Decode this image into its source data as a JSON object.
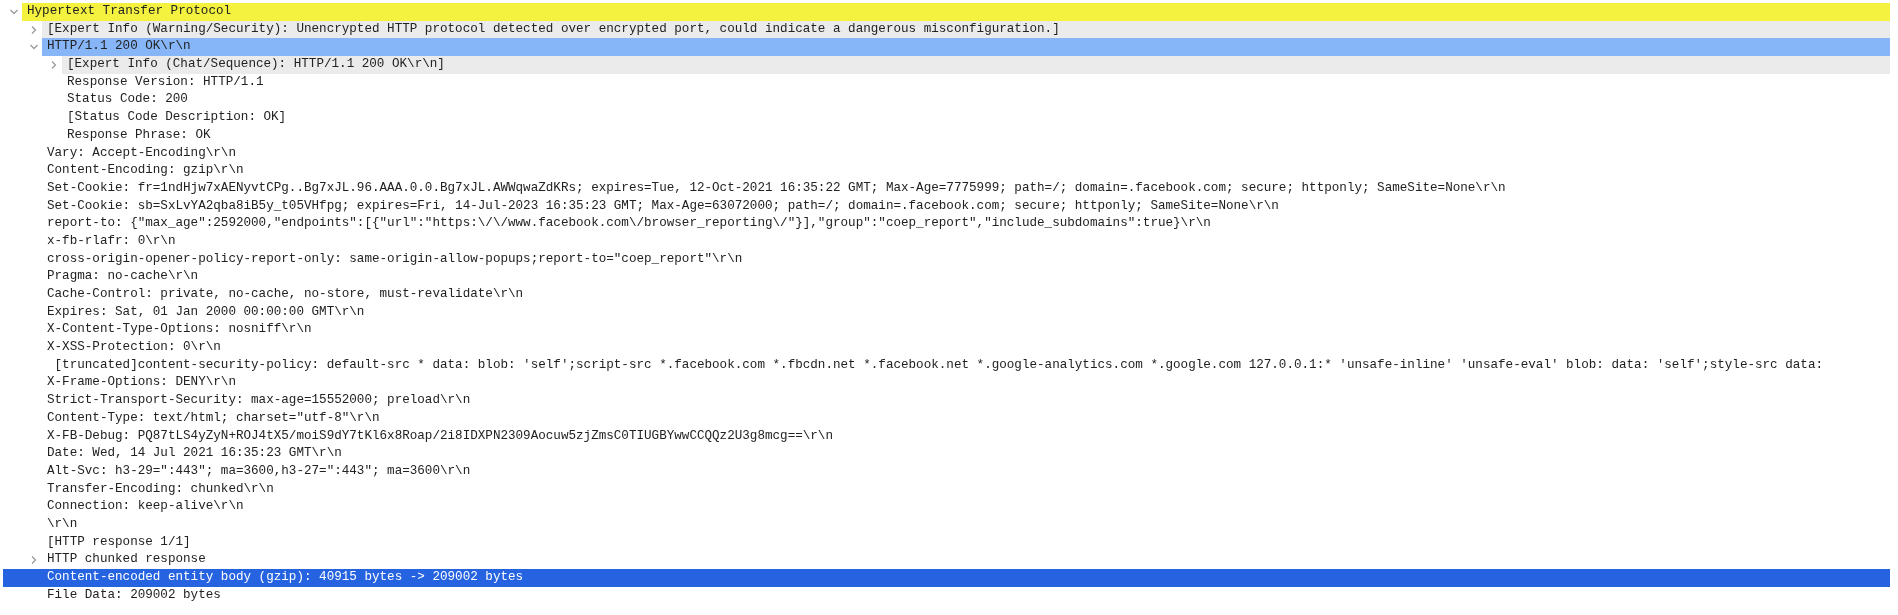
{
  "tree": [
    {
      "label": "Hypertext Transfer Protocol",
      "expanded": true,
      "color": "#f4f23e",
      "selected": false,
      "children": [
        {
          "label": "[Expert Info (Warning/Security): Unencrypted HTTP protocol detected over encrypted port, could indicate a dangerous misconfiguration.]",
          "expanded": false,
          "color": "#ebebeb",
          "selected": false
        },
        {
          "label": "HTTP/1.1 200 OK\\r\\n",
          "expanded": true,
          "color": "#86b6f8",
          "selected": false,
          "children": [
            {
              "label": "[Expert Info (Chat/Sequence): HTTP/1.1 200 OK\\r\\n]",
              "expanded": false,
              "color": "#ebebeb",
              "selected": false
            },
            {
              "label": "Response Version: HTTP/1.1",
              "selected": false
            },
            {
              "label": "Status Code: 200",
              "selected": false
            },
            {
              "label": "[Status Code Description: OK]",
              "selected": false
            },
            {
              "label": "Response Phrase: OK",
              "selected": false
            }
          ]
        },
        {
          "label": "Vary: Accept-Encoding\\r\\n",
          "selected": false
        },
        {
          "label": "Content-Encoding: gzip\\r\\n",
          "selected": false
        },
        {
          "label": "Set-Cookie: fr=1ndHjw7xAENyvtCPg..Bg7xJL.96.AAA.0.0.Bg7xJL.AWWqwaZdKRs; expires=Tue, 12-Oct-2021 16:35:22 GMT; Max-Age=7775999; path=/; domain=.facebook.com; secure; httponly; SameSite=None\\r\\n",
          "selected": false
        },
        {
          "label": "Set-Cookie: sb=SxLvYA2qba8iB5y_t05VHfpg; expires=Fri, 14-Jul-2023 16:35:23 GMT; Max-Age=63072000; path=/; domain=.facebook.com; secure; httponly; SameSite=None\\r\\n",
          "selected": false
        },
        {
          "label": "report-to: {\"max_age\":2592000,\"endpoints\":[{\"url\":\"https:\\/\\/www.facebook.com\\/browser_reporting\\/\"}],\"group\":\"coep_report\",\"include_subdomains\":true}\\r\\n",
          "selected": false
        },
        {
          "label": "x-fb-rlafr: 0\\r\\n",
          "selected": false
        },
        {
          "label": "cross-origin-opener-policy-report-only: same-origin-allow-popups;report-to=\"coep_report\"\\r\\n",
          "selected": false
        },
        {
          "label": "Pragma: no-cache\\r\\n",
          "selected": false
        },
        {
          "label": "Cache-Control: private, no-cache, no-store, must-revalidate\\r\\n",
          "selected": false
        },
        {
          "label": "Expires: Sat, 01 Jan 2000 00:00:00 GMT\\r\\n",
          "selected": false
        },
        {
          "label": "X-Content-Type-Options: nosniff\\r\\n",
          "selected": false
        },
        {
          "label": "X-XSS-Protection: 0\\r\\n",
          "selected": false
        },
        {
          "label": " [truncated]content-security-policy: default-src * data: blob: 'self';script-src *.facebook.com *.fbcdn.net *.facebook.net *.google-analytics.com *.google.com 127.0.0.1:* 'unsafe-inline' 'unsafe-eval' blob: data: 'self';style-src data:",
          "selected": false
        },
        {
          "label": "X-Frame-Options: DENY\\r\\n",
          "selected": false
        },
        {
          "label": "Strict-Transport-Security: max-age=15552000; preload\\r\\n",
          "selected": false
        },
        {
          "label": "Content-Type: text/html; charset=\"utf-8\"\\r\\n",
          "selected": false
        },
        {
          "label": "X-FB-Debug: PQ87tLS4yZyN+ROJ4tX5/moiS9dY7tKl6x8Roap/2i8IDXPN2309Aocuw5zjZmsC0TIUGBYwwCCQQz2U3g8mcg==\\r\\n",
          "selected": false
        },
        {
          "label": "Date: Wed, 14 Jul 2021 16:35:23 GMT\\r\\n",
          "selected": false
        },
        {
          "label": "Alt-Svc: h3-29=\":443\"; ma=3600,h3-27=\":443\"; ma=3600\\r\\n",
          "selected": false
        },
        {
          "label": "Transfer-Encoding: chunked\\r\\n",
          "selected": false
        },
        {
          "label": "Connection: keep-alive\\r\\n",
          "selected": false
        },
        {
          "label": "\\r\\n",
          "selected": false
        },
        {
          "label": "[HTTP response 1/1]",
          "selected": false
        },
        {
          "label": "HTTP chunked response",
          "expanded": false,
          "selected": false
        },
        {
          "label": "Content-encoded entity body (gzip): 40915 bytes -> 209002 bytes",
          "selected": true
        },
        {
          "label": "File Data: 209002 bytes",
          "selected": false
        }
      ]
    }
  ]
}
